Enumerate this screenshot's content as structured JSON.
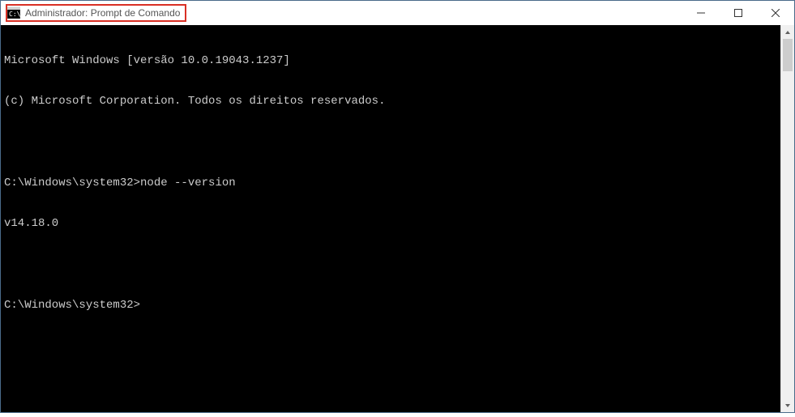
{
  "window": {
    "title": "Administrador: Prompt de Comando"
  },
  "terminal": {
    "lines": [
      "Microsoft Windows [versão 10.0.19043.1237]",
      "(c) Microsoft Corporation. Todos os direitos reservados.",
      "",
      "C:\\Windows\\system32>node --version",
      "v14.18.0",
      "",
      "C:\\Windows\\system32>"
    ]
  }
}
